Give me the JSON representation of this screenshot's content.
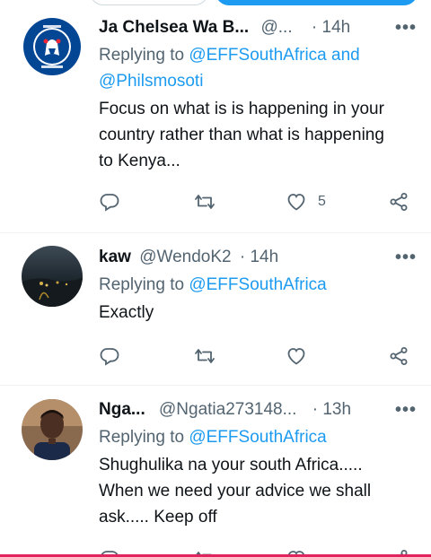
{
  "tweets": [
    {
      "name": "Ja Chelsea Wa B...",
      "handle": "@...",
      "dot": "·",
      "time": "14h",
      "replying_prefix": "Replying to",
      "replying_mentions": "@EFFSouthAfrica and @Philsmosoti",
      "text": "Focus on what is is happening in your country rather than what is happening to Kenya...",
      "like_count": "5",
      "avatar": "chelsea-fc-crest"
    },
    {
      "name": "kaw",
      "handle": "@WendoK2",
      "dot": "·",
      "time": "14h",
      "replying_prefix": "Replying to",
      "replying_mentions": "@EFFSouthAfrica",
      "text": "Exactly",
      "like_count": "",
      "avatar": "night-city-photo"
    },
    {
      "name": "Nga...",
      "handle": "@Ngatia273148...",
      "dot": "·",
      "time": "13h",
      "replying_prefix": "Replying to",
      "replying_mentions": "@EFFSouthAfrica",
      "text": "Shughulika na your south Africa..... When we need your advice we shall ask..... Keep off",
      "like_count": "",
      "avatar": "person-photo"
    }
  ],
  "icons": {
    "reply": "reply-icon",
    "retweet": "retweet-icon",
    "like": "heart-icon",
    "share": "share-icon",
    "more": "more-options-icon"
  },
  "colors": {
    "link": "#1d9bf0",
    "secondary_text": "#536471",
    "primary_text": "#0f1419",
    "bottom_bar": "#e0245e"
  }
}
